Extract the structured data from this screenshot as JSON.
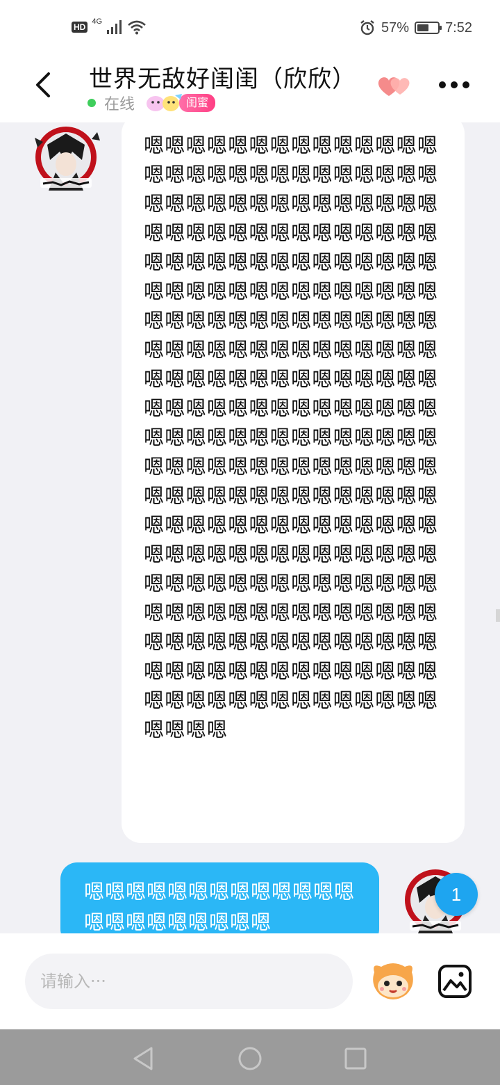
{
  "status_bar": {
    "hd_label": "HD",
    "network_label": "4G",
    "battery_percent": "57%",
    "battery_level": 0.57,
    "time": "7:52"
  },
  "header": {
    "title": "世界无敌好闺闺（欣欣）",
    "online_status": "在线",
    "relation_badge": "闺蜜"
  },
  "messages": {
    "incoming": {
      "text": "嗯嗯嗯嗯嗯嗯嗯嗯嗯嗯嗯嗯嗯嗯嗯嗯嗯嗯嗯嗯嗯嗯嗯嗯嗯嗯嗯嗯嗯嗯嗯嗯嗯嗯嗯嗯嗯嗯嗯嗯嗯嗯嗯嗯嗯嗯嗯嗯嗯嗯嗯嗯嗯嗯嗯嗯嗯嗯嗯嗯嗯嗯嗯嗯嗯嗯嗯嗯嗯嗯嗯嗯嗯嗯嗯嗯嗯嗯嗯嗯嗯嗯嗯嗯嗯嗯嗯嗯嗯嗯嗯嗯嗯嗯嗯嗯嗯嗯嗯嗯嗯嗯嗯嗯嗯嗯嗯嗯嗯嗯嗯嗯嗯嗯嗯嗯嗯嗯嗯嗯嗯嗯嗯嗯嗯嗯嗯嗯嗯嗯嗯嗯嗯嗯嗯嗯嗯嗯嗯嗯嗯嗯嗯嗯嗯嗯嗯嗯嗯嗯嗯嗯嗯嗯嗯嗯嗯嗯嗯嗯嗯嗯嗯嗯嗯嗯嗯嗯嗯嗯嗯嗯嗯嗯嗯嗯嗯嗯嗯嗯嗯嗯嗯嗯嗯嗯嗯嗯嗯嗯嗯嗯嗯嗯嗯嗯嗯嗯嗯嗯嗯嗯嗯嗯嗯嗯嗯嗯嗯嗯嗯嗯嗯嗯嗯嗯嗯嗯嗯嗯嗯嗯嗯嗯嗯嗯嗯嗯嗯嗯嗯嗯嗯嗯嗯嗯嗯嗯嗯嗯嗯嗯嗯嗯嗯嗯嗯嗯嗯嗯嗯嗯嗯嗯嗯嗯嗯嗯嗯嗯嗯嗯嗯嗯嗯嗯嗯嗯嗯嗯嗯嗯嗯嗯嗯嗯嗯嗯嗯嗯嗯嗯嗯嗯"
    },
    "outgoing": {
      "text": "嗯嗯嗯嗯嗯嗯嗯嗯嗯嗯嗯嗯嗯嗯嗯嗯嗯嗯嗯嗯嗯嗯",
      "unread_count": "1"
    }
  },
  "input_bar": {
    "placeholder": "请输入···"
  },
  "colors": {
    "outgoing_bubble": "#2bb7f6",
    "online_dot": "#3fce5c",
    "badge_pink": "#ff3f84",
    "chat_background": "#f1f1f5"
  },
  "icons": {
    "back": "chevron-left-icon",
    "hearts": "hearts-icon",
    "more": "more-dots-icon",
    "emoji": "emoji-face-icon",
    "image": "image-icon"
  }
}
